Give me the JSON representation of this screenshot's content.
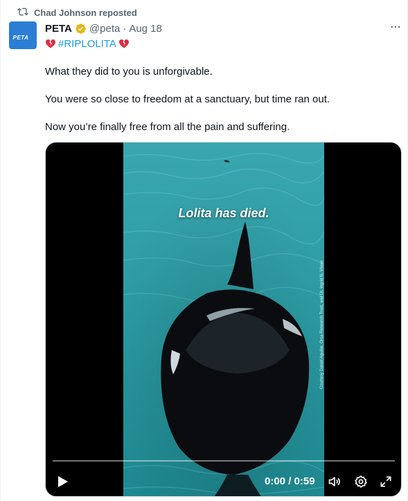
{
  "repost": {
    "text": "Chad Johnson reposted",
    "icon": "repost-icon"
  },
  "author": {
    "name": "PETA",
    "handle": "@peta",
    "separator": "·",
    "date": "Aug 18",
    "avatar_text": "PETA"
  },
  "tweet": {
    "hashtag": "#RIPLOLITA",
    "lines": [
      "What they did to you is unforgivable.",
      "You were so close to freedom at a sanctuary, but time ran out.",
      "Now you’re finally free from all the pain and suffering."
    ]
  },
  "video": {
    "caption": "Lolita has died.",
    "credit": "Courtesy Daniel Aguilar, Orca Research Trust, and Dr. Ingrid N. Visser",
    "time": "0:00 / 0:59",
    "progress": 0
  },
  "colors": {
    "link": "#1d9bf0",
    "secondary": "#536471",
    "verified": "#e2b719",
    "water": "#2fa3a8"
  }
}
